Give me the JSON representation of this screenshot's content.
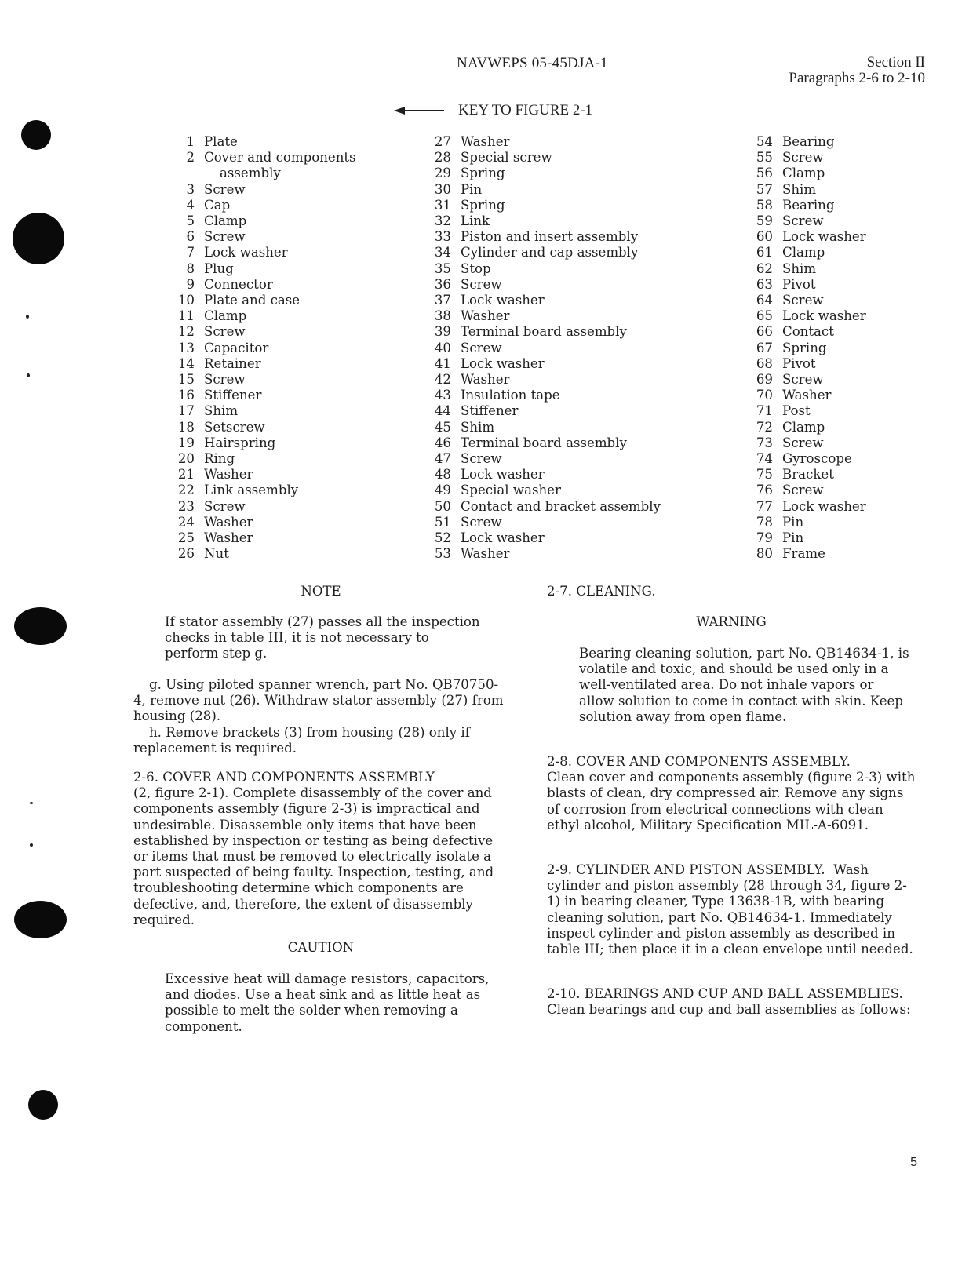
{
  "header": {
    "doc_id": "NAVWEPS 05-45DJA-1",
    "section": "Section II",
    "paragraphs": "Paragraphs 2-6 to 2-10"
  },
  "key": {
    "title": "KEY TO FIGURE 2-1",
    "arrow_icon": "left-arrow",
    "columns": [
      [
        {
          "num": "1",
          "label": "Plate"
        },
        {
          "num": "2",
          "label": "Cover and components",
          "cont": "assembly"
        },
        {
          "num": "3",
          "label": "Screw"
        },
        {
          "num": "4",
          "label": "Cap"
        },
        {
          "num": "5",
          "label": "Clamp"
        },
        {
          "num": "6",
          "label": "Screw"
        },
        {
          "num": "7",
          "label": "Lock washer"
        },
        {
          "num": "8",
          "label": "Plug"
        },
        {
          "num": "9",
          "label": "Connector"
        },
        {
          "num": "10",
          "label": "Plate and case"
        },
        {
          "num": "11",
          "label": "Clamp"
        },
        {
          "num": "12",
          "label": "Screw"
        },
        {
          "num": "13",
          "label": "Capacitor"
        },
        {
          "num": "14",
          "label": "Retainer"
        },
        {
          "num": "15",
          "label": "Screw"
        },
        {
          "num": "16",
          "label": "Stiffener"
        },
        {
          "num": "17",
          "label": "Shim"
        },
        {
          "num": "18",
          "label": "Setscrew"
        },
        {
          "num": "19",
          "label": "Hairspring"
        },
        {
          "num": "20",
          "label": "Ring"
        },
        {
          "num": "21",
          "label": "Washer"
        },
        {
          "num": "22",
          "label": "Link assembly"
        },
        {
          "num": "23",
          "label": "Screw"
        },
        {
          "num": "24",
          "label": "Washer"
        },
        {
          "num": "25",
          "label": "Washer"
        },
        {
          "num": "26",
          "label": "Nut"
        }
      ],
      [
        {
          "num": "27",
          "label": "Washer"
        },
        {
          "num": "28",
          "label": "Special screw"
        },
        {
          "num": "29",
          "label": "Spring"
        },
        {
          "num": "30",
          "label": "Pin"
        },
        {
          "num": "31",
          "label": "Spring"
        },
        {
          "num": "32",
          "label": "Link"
        },
        {
          "num": "33",
          "label": "Piston and insert assembly"
        },
        {
          "num": "34",
          "label": "Cylinder and cap assembly"
        },
        {
          "num": "35",
          "label": "Stop"
        },
        {
          "num": "36",
          "label": "Screw"
        },
        {
          "num": "37",
          "label": "Lock washer"
        },
        {
          "num": "38",
          "label": "Washer"
        },
        {
          "num": "39",
          "label": "Terminal board assembly"
        },
        {
          "num": "40",
          "label": "Screw"
        },
        {
          "num": "41",
          "label": "Lock washer"
        },
        {
          "num": "42",
          "label": "Washer"
        },
        {
          "num": "43",
          "label": "Insulation tape"
        },
        {
          "num": "44",
          "label": "Stiffener"
        },
        {
          "num": "45",
          "label": "Shim"
        },
        {
          "num": "46",
          "label": "Terminal board assembly"
        },
        {
          "num": "47",
          "label": "Screw"
        },
        {
          "num": "48",
          "label": "Lock washer"
        },
        {
          "num": "49",
          "label": "Special washer"
        },
        {
          "num": "50",
          "label": "Contact and bracket assembly"
        },
        {
          "num": "51",
          "label": "Screw"
        },
        {
          "num": "52",
          "label": "Lock washer"
        },
        {
          "num": "53",
          "label": "Washer"
        }
      ],
      [
        {
          "num": "54",
          "label": "Bearing"
        },
        {
          "num": "55",
          "label": "Screw"
        },
        {
          "num": "56",
          "label": "Clamp"
        },
        {
          "num": "57",
          "label": "Shim"
        },
        {
          "num": "58",
          "label": "Bearing"
        },
        {
          "num": "59",
          "label": "Screw"
        },
        {
          "num": "60",
          "label": "Lock washer"
        },
        {
          "num": "61",
          "label": "Clamp"
        },
        {
          "num": "62",
          "label": "Shim"
        },
        {
          "num": "63",
          "label": "Pivot"
        },
        {
          "num": "64",
          "label": "Screw"
        },
        {
          "num": "65",
          "label": "Lock washer"
        },
        {
          "num": "66",
          "label": "Contact"
        },
        {
          "num": "67",
          "label": "Spring"
        },
        {
          "num": "68",
          "label": "Pivot"
        },
        {
          "num": "69",
          "label": "Screw"
        },
        {
          "num": "70",
          "label": "Washer"
        },
        {
          "num": "71",
          "label": "Post"
        },
        {
          "num": "72",
          "label": "Clamp"
        },
        {
          "num": "73",
          "label": "Screw"
        },
        {
          "num": "74",
          "label": "Gyroscope"
        },
        {
          "num": "75",
          "label": "Bracket"
        },
        {
          "num": "76",
          "label": "Screw"
        },
        {
          "num": "77",
          "label": "Lock washer"
        },
        {
          "num": "78",
          "label": "Pin"
        },
        {
          "num": "79",
          "label": "Pin"
        },
        {
          "num": "80",
          "label": "Frame"
        }
      ]
    ]
  },
  "left": {
    "note_heading": "NOTE",
    "note_text": "If stator assembly (27) passes all the inspection checks in table III, it is not necessary to perform step g.",
    "step_g": "g.  Using piloted spanner wrench, part No. QB70750-4, remove nut (26).  Withdraw stator assembly (27) from housing (28).",
    "step_h": "h.  Remove brackets (3) from housing (28) only if replacement is required.",
    "para_2_6_heading": "2-6.  COVER AND COMPONENTS ASSEMBLY",
    "para_2_6_text": "(2, figure 2-1).  Complete disassembly of the cover and components assembly (figure 2-3) is impractical and undesirable.  Disassemble only items that have been established by inspection or testing as being defective or items that must be removed to electrically isolate a part suspected of being faulty.  Inspection, testing, and troubleshooting determine which components are defective, and, therefore, the extent of disassembly required.",
    "caution_heading": "CAUTION",
    "caution_text": "Excessive heat will damage resistors, capacitors, and diodes.  Use a heat sink and as little heat as possible to melt the solder when removing a component."
  },
  "right": {
    "para_2_7_heading": "2-7.  CLEANING.",
    "warning_heading": "WARNING",
    "warning_text": "Bearing cleaning solution, part No. QB14634-1, is volatile and toxic, and should be used only in a well-ventilated area.  Do not inhale vapors or allow solution to come in contact with skin.  Keep solution away from open flame.",
    "para_2_8_heading": "2-8.  COVER AND COMPONENTS ASSEMBLY.",
    "para_2_8_text": "Clean cover and components assembly (figure 2-3) with blasts of clean, dry compressed air.  Remove any signs of corrosion from electrical connections with clean ethyl alcohol, Military Specification MIL-A-6091.",
    "para_2_9_heading": "2-9.  CYLINDER AND PISTON ASSEMBLY.",
    "para_2_9_text": "Wash cylinder and piston assembly (28 through 34, figure 2-1) in bearing cleaner, Type 13638-1B, with bearing cleaning solution, part No. QB14634-1.  Immediately inspect cylinder and piston assembly as described in table III; then place it in a clean envelope until needed.",
    "para_2_10_heading": "2-10.  BEARINGS AND CUP AND BALL ASSEMBLIES.",
    "para_2_10_text": "Clean bearings and cup and ball assemblies as follows:"
  },
  "footer": {
    "page_number": "5"
  }
}
